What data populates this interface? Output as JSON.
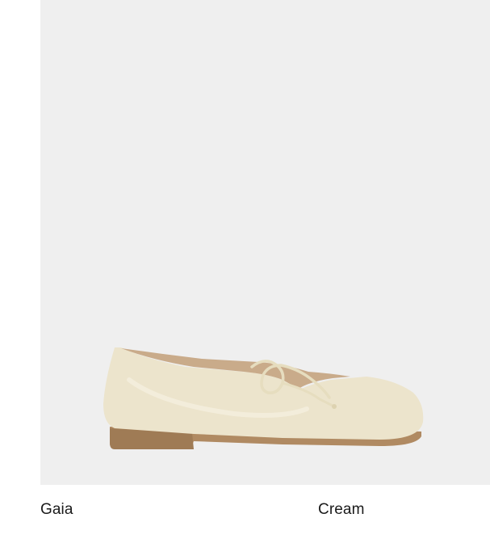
{
  "product": {
    "name": "Gaia",
    "color": "Cream",
    "image_icon": "ballet-flat-shoe-image",
    "image_background": "#efefef",
    "shoe_upper_color": "#ece4cc",
    "sole_color": "#b08a62"
  }
}
